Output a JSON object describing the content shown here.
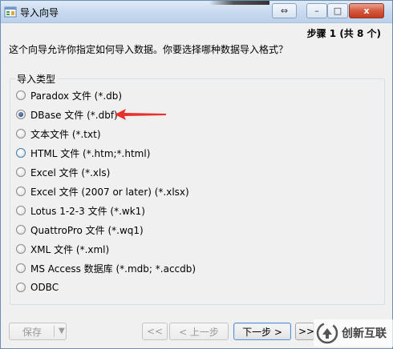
{
  "window": {
    "title": "导入向导"
  },
  "title_buttons": {
    "resize": "⇔",
    "minimize": "–",
    "maximize": "□",
    "close": "x"
  },
  "step": "步骤 1 (共 8 个)",
  "intro": "这个向导允许你指定如何导入数据。你要选择哪种数据导入格式？",
  "group": {
    "label": "导入类型",
    "options": [
      {
        "label": "Paradox 文件 (*.db)",
        "checked": false
      },
      {
        "label": "DBase 文件 (*.dbf)",
        "checked": true
      },
      {
        "label": "文本文件 (*.txt)",
        "checked": false
      },
      {
        "label": "HTML 文件 (*.htm;*.html)",
        "checked": false,
        "hover": true
      },
      {
        "label": "Excel 文件 (*.xls)",
        "checked": false
      },
      {
        "label": "Excel 文件 (2007 or later) (*.xlsx)",
        "checked": false
      },
      {
        "label": "Lotus 1-2-3 文件 (*.wk1)",
        "checked": false
      },
      {
        "label": "QuattroPro 文件 (*.wq1)",
        "checked": false
      },
      {
        "label": "XML 文件 (*.xml)",
        "checked": false
      },
      {
        "label": "MS Access 数据库 (*.mdb; *.accdb)",
        "checked": false
      },
      {
        "label": "ODBC",
        "checked": false
      }
    ]
  },
  "footer": {
    "save": "保存",
    "first": "<<",
    "prev": "< 上一步",
    "next": "下一步 >",
    "last": ">>"
  },
  "watermark": {
    "text": "创新互联"
  },
  "colors": {
    "arrow": "#e8312c",
    "accent": "#3c7fb1"
  }
}
